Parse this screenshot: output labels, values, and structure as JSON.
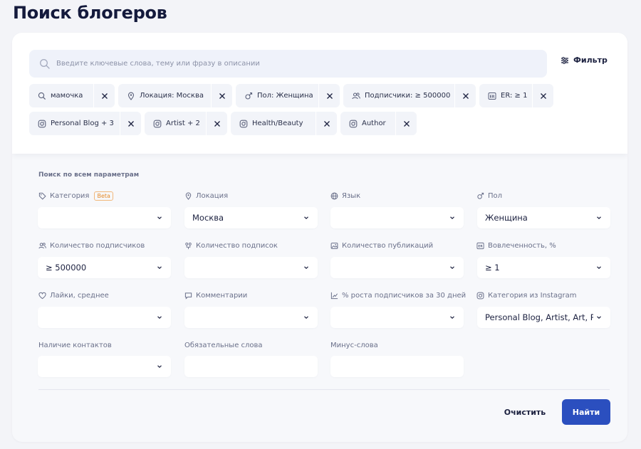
{
  "page": {
    "title": "Поиск блогеров"
  },
  "search": {
    "placeholder": "Введите ключевые слова, тему или фразу в описании",
    "filter_label": "Фильтр"
  },
  "chips": [
    {
      "label": "мамочка",
      "icon": "keyword-search-icon"
    },
    {
      "label": "Локация: Москва",
      "icon": "location-pin-icon"
    },
    {
      "label": "Пол: Женщина",
      "icon": "gender-icon"
    },
    {
      "label": "Подписчики: ≥ 500000",
      "icon": "followers-icon"
    },
    {
      "label": "ER: ≥ 1",
      "icon": "er-icon"
    },
    {
      "label": "Personal Blog + 3",
      "icon": "instagram-icon"
    },
    {
      "label": "Artist + 2",
      "icon": "instagram-icon"
    },
    {
      "label": "Health/Beauty",
      "icon": "instagram-icon"
    },
    {
      "label": "Author",
      "icon": "instagram-icon"
    }
  ],
  "params": {
    "title": "Поиск по всем параметрам",
    "category": {
      "label": "Категория",
      "badge": "Beta",
      "value": ""
    },
    "location": {
      "label": "Локация",
      "value": "Москва"
    },
    "language": {
      "label": "Язык",
      "value": ""
    },
    "gender": {
      "label": "Пол",
      "value": "Женщина"
    },
    "followers": {
      "label": "Количество подписчиков",
      "value": "≥ 500000"
    },
    "following": {
      "label": "Количество подписок",
      "value": ""
    },
    "posts": {
      "label": "Количество публикаций",
      "value": ""
    },
    "engagement": {
      "label": "Вовлеченность, %",
      "value": "≥ 1"
    },
    "likes": {
      "label": "Лайки, среднее",
      "value": ""
    },
    "comments": {
      "label": "Комментарии",
      "value": ""
    },
    "growth": {
      "label": "% роста подписчиков за 30 дней",
      "value": ""
    },
    "ig_category": {
      "label": "Категория из Instagram",
      "value": "Personal Blog, Artist, Art, Public Figure"
    },
    "contacts": {
      "label": "Наличие контактов",
      "value": ""
    },
    "required_words": {
      "label": "Обязательные слова",
      "value": ""
    },
    "minus_words": {
      "label": "Минус-слова",
      "value": ""
    }
  },
  "actions": {
    "clear": "Очистить",
    "search": "Найти"
  },
  "colors": {
    "accent": "#2b4fbf",
    "beta": "#e58b28",
    "text": "#1c2140",
    "muted": "#6a708a"
  }
}
